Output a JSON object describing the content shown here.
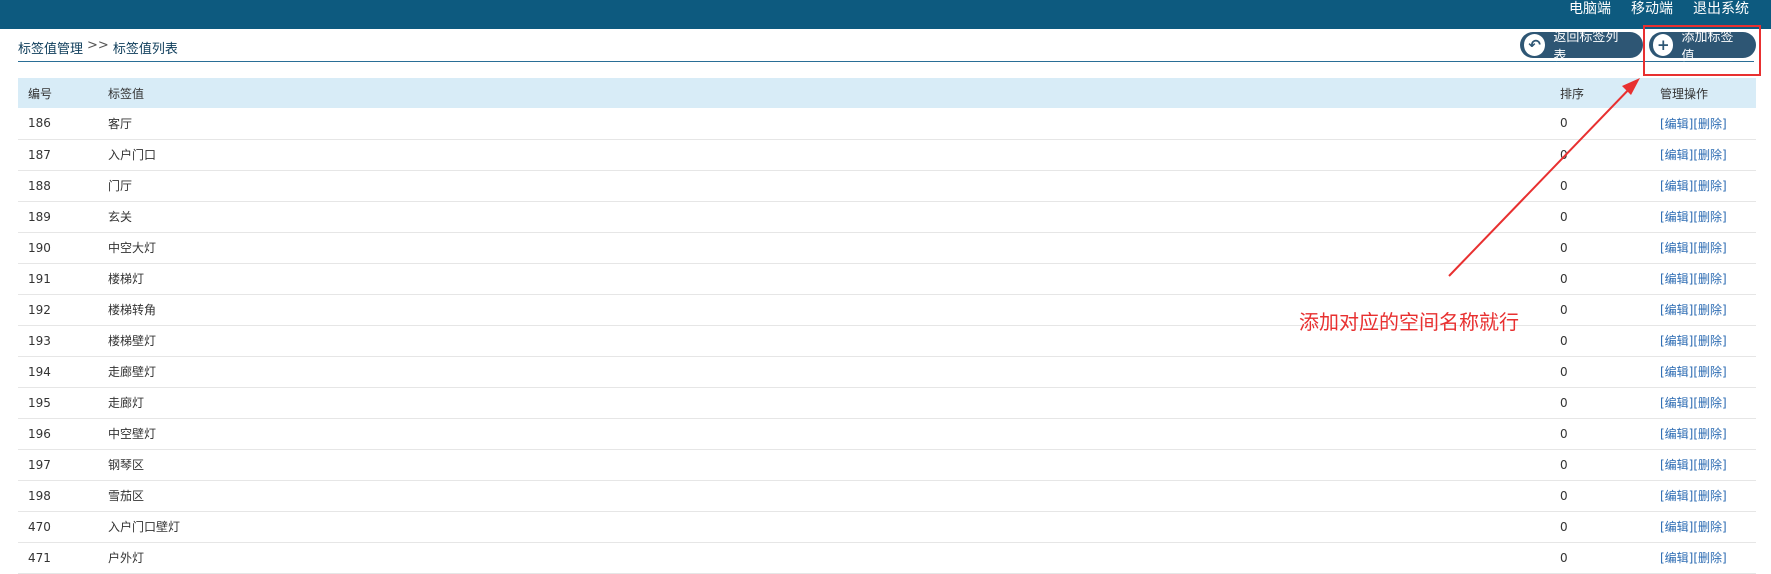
{
  "topbar": {
    "links": [
      "电脑端",
      "移动端",
      "退出系统"
    ]
  },
  "breadcrumb": {
    "parent": "标签值管理",
    "separator": ">>",
    "current": "标签值列表"
  },
  "buttons": {
    "back_label": "返回标签列表",
    "add_label": "添加标签值"
  },
  "table": {
    "headers": [
      "编号",
      "标签值",
      "排序",
      "管理操作"
    ],
    "edit_label": "[编辑]",
    "delete_label": "[删除]",
    "rows": [
      {
        "id": "186",
        "value": "客厅",
        "order": "0"
      },
      {
        "id": "187",
        "value": "入户门口",
        "order": "0"
      },
      {
        "id": "188",
        "value": "门厅",
        "order": "0"
      },
      {
        "id": "189",
        "value": "玄关",
        "order": "0"
      },
      {
        "id": "190",
        "value": "中空大灯",
        "order": "0"
      },
      {
        "id": "191",
        "value": "楼梯灯",
        "order": "0"
      },
      {
        "id": "192",
        "value": "楼梯转角",
        "order": "0"
      },
      {
        "id": "193",
        "value": "楼梯壁灯",
        "order": "0"
      },
      {
        "id": "194",
        "value": "走廊壁灯",
        "order": "0"
      },
      {
        "id": "195",
        "value": "走廊灯",
        "order": "0"
      },
      {
        "id": "196",
        "value": "中空壁灯",
        "order": "0"
      },
      {
        "id": "197",
        "value": "钢琴区",
        "order": "0"
      },
      {
        "id": "198",
        "value": "雪茄区",
        "order": "0"
      },
      {
        "id": "470",
        "value": "入户门口壁灯",
        "order": "0"
      },
      {
        "id": "471",
        "value": "户外灯",
        "order": "0"
      }
    ]
  },
  "annotation": {
    "text": "添加对应的空间名称就行",
    "color": "#e83030"
  }
}
